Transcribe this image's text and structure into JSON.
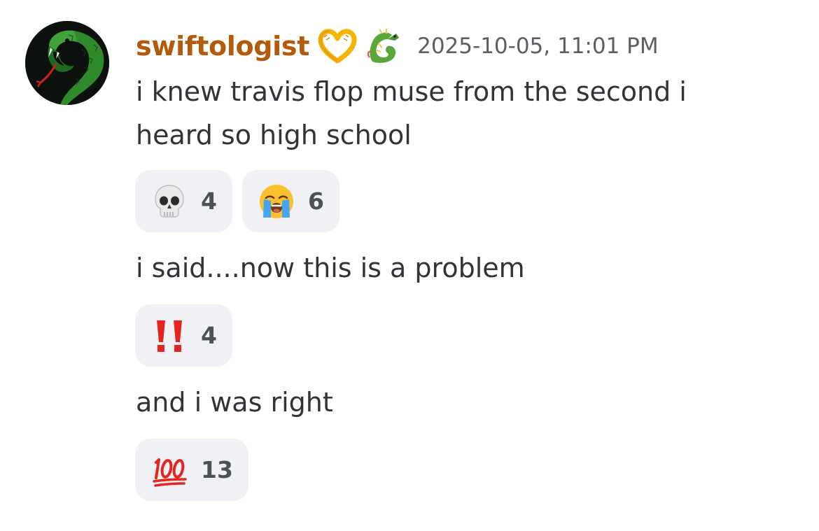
{
  "message": {
    "author": {
      "username": "swiftologist",
      "avatar_icon": "green-snake-icon",
      "badges": [
        "heart-hands-icon",
        "dragon-icon"
      ]
    },
    "timestamp": "2025-10-05, 11:01 PM",
    "lines": [
      {
        "text": "i knew travis flop muse from the second i",
        "text2": "heard so high school",
        "reactions": [
          {
            "emoji": "skull-icon",
            "count": "4"
          },
          {
            "emoji": "loudly-crying-face-icon",
            "count": "6"
          }
        ]
      },
      {
        "text": "i said....now this is a problem",
        "reactions": [
          {
            "emoji": "double-exclamation-icon",
            "count": "4"
          }
        ]
      },
      {
        "text": "and i was right",
        "reactions": [
          {
            "emoji": "hundred-points-icon",
            "count": "13"
          }
        ]
      }
    ]
  },
  "colors": {
    "username": "#b35a0b",
    "text": "#313338",
    "timestamp": "#5c5e66",
    "reaction_bg": "#f0f1f4",
    "reaction_count": "#4e5058"
  }
}
